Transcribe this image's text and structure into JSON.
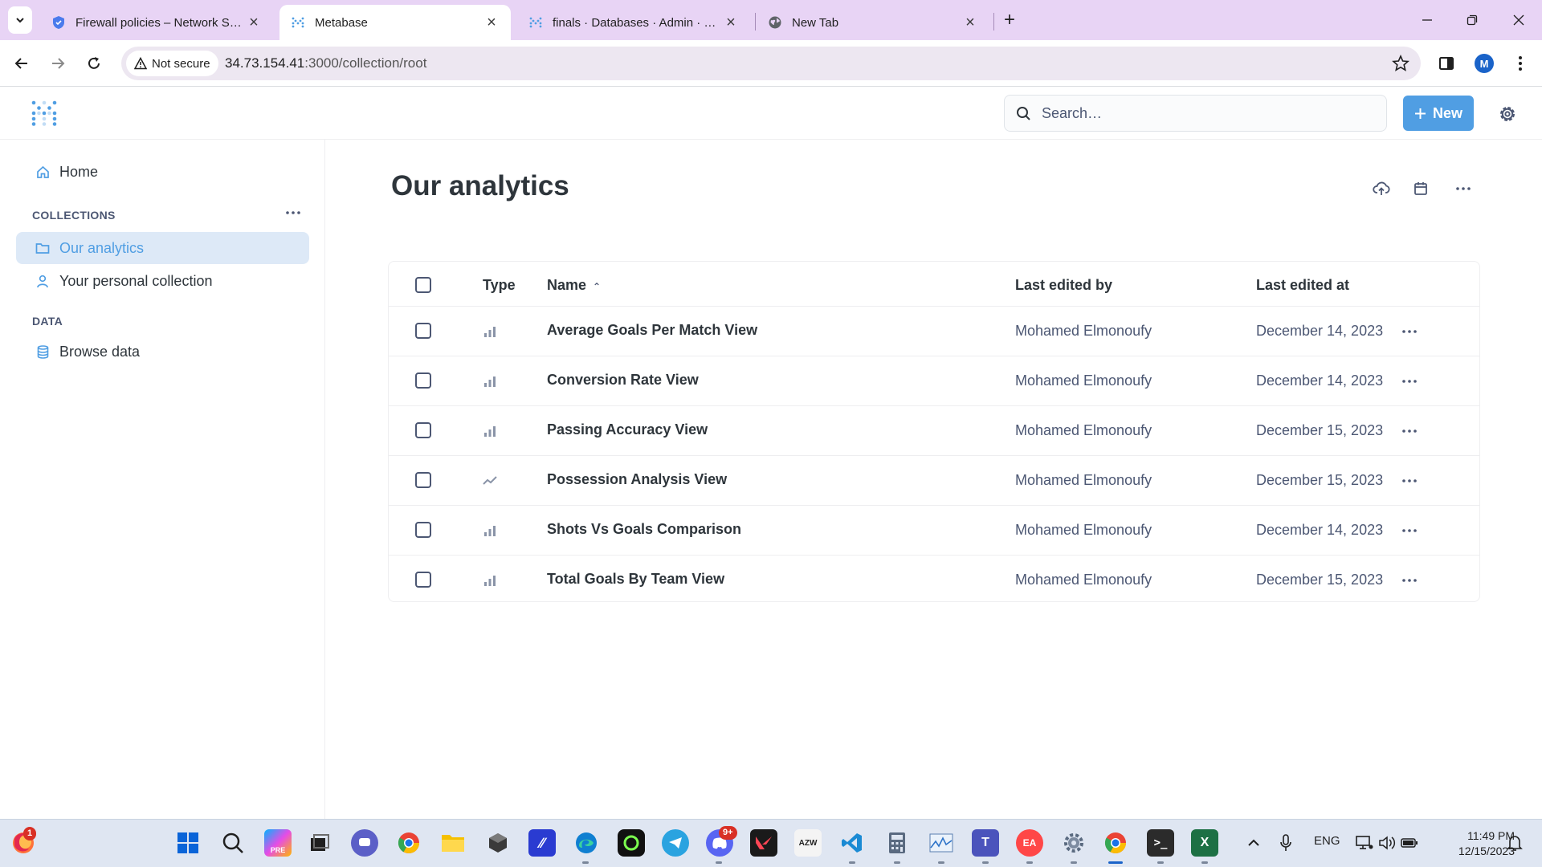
{
  "browser": {
    "tabs": [
      {
        "title": "Firewall policies – Network Secu",
        "active": false
      },
      {
        "title": "Metabase",
        "active": true
      },
      {
        "title": "finals · Databases · Admin · Met",
        "active": false
      },
      {
        "title": "New Tab",
        "active": false
      }
    ],
    "security_label": "Not secure",
    "url_host": "34.73.154.41",
    "url_path": ":3000/collection/root",
    "profile_initial": "M"
  },
  "header": {
    "search_placeholder": "Search…",
    "new_label": "New"
  },
  "sidebar": {
    "home_label": "Home",
    "collections_heading": "COLLECTIONS",
    "collections": [
      {
        "label": "Our analytics",
        "active": true
      },
      {
        "label": "Your personal collection",
        "active": false
      }
    ],
    "data_heading": "DATA",
    "browse_label": "Browse data"
  },
  "main": {
    "title": "Our analytics",
    "columns": {
      "type": "Type",
      "name": "Name",
      "sort_indicator": "⌃",
      "editor": "Last edited by",
      "edited_at": "Last edited at"
    },
    "rows": [
      {
        "type_icon": "bar-chart-icon",
        "name": "Average Goals Per Match View",
        "editor": "Mohamed Elmonoufy",
        "edited_at": "December 14, 2023"
      },
      {
        "type_icon": "bar-chart-icon",
        "name": "Conversion Rate View",
        "editor": "Mohamed Elmonoufy",
        "edited_at": "December 14, 2023"
      },
      {
        "type_icon": "bar-chart-icon",
        "name": "Passing Accuracy View",
        "editor": "Mohamed Elmonoufy",
        "edited_at": "December 15, 2023"
      },
      {
        "type_icon": "line-chart-icon",
        "name": "Possession Analysis View",
        "editor": "Mohamed Elmonoufy",
        "edited_at": "December 15, 2023"
      },
      {
        "type_icon": "bar-chart-icon",
        "name": "Shots Vs Goals Comparison",
        "editor": "Mohamed Elmonoufy",
        "edited_at": "December 14, 2023"
      },
      {
        "type_icon": "bar-chart-icon",
        "name": "Total Goals By Team View",
        "editor": "Mohamed Elmonoufy",
        "edited_at": "December 15, 2023"
      }
    ]
  },
  "taskbar": {
    "firefox_badge": "1",
    "discord_badge": "9+",
    "tray_lang": "ENG",
    "time": "11:49 PM",
    "date": "12/15/2023"
  },
  "colors": {
    "brand": "#509ee3",
    "active_bg": "#dde9f7",
    "text": "#2e353b",
    "muted": "#4c5773",
    "tabbar": "#e8d4f5"
  }
}
